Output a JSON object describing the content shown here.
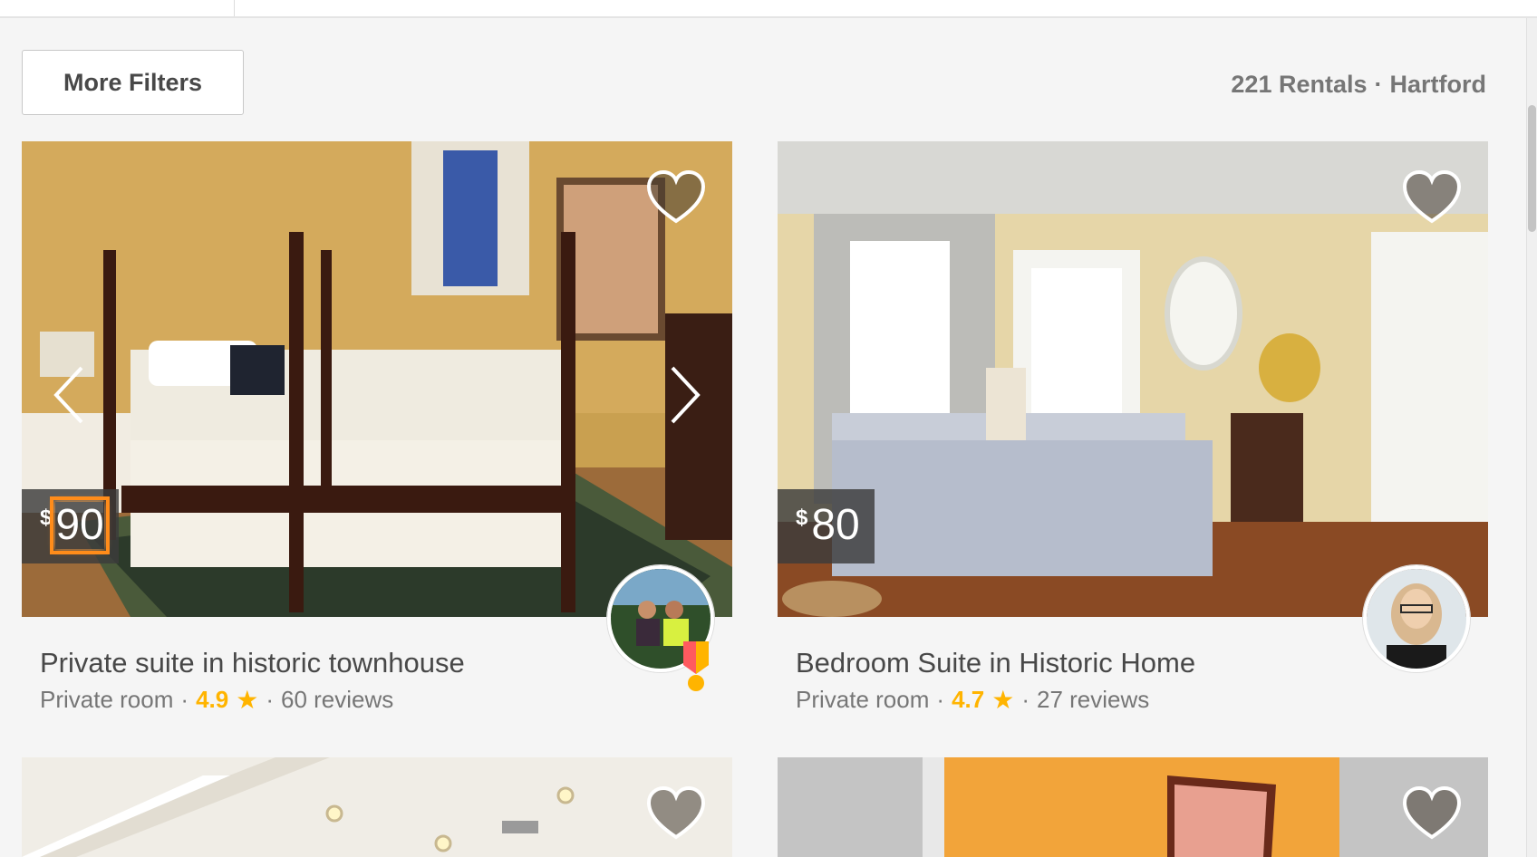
{
  "filters": {
    "more_filters_label": "More Filters"
  },
  "summary": {
    "count_text": "221 Rentals",
    "separator": "·",
    "city": "Hartford"
  },
  "listings": [
    {
      "currency": "$",
      "price": "90",
      "title": "Private suite in historic townhouse",
      "room_type": "Private room",
      "rating": "4.9",
      "reviews": "60 reviews"
    },
    {
      "currency": "$",
      "price": "80",
      "title": "Bedroom Suite in Historic Home",
      "room_type": "Private room",
      "rating": "4.7",
      "reviews": "27 reviews"
    }
  ],
  "colors": {
    "accent_star": "#ffb400",
    "focus_outline": "#ff8c1a",
    "background": "#f5f5f5"
  },
  "icons": [
    "heart-icon",
    "chevron-left-icon",
    "chevron-right-icon",
    "star-icon",
    "superhost-badge-icon"
  ]
}
